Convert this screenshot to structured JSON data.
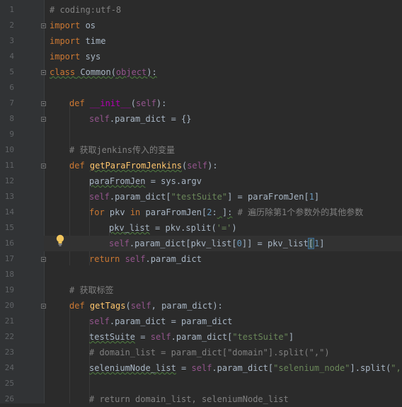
{
  "line_numbers": [
    "1",
    "2",
    "3",
    "4",
    "5",
    "6",
    "7",
    "8",
    "9",
    "10",
    "11",
    "12",
    "13",
    "14",
    "15",
    "16",
    "17",
    "18",
    "19",
    "20",
    "21",
    "22",
    "23",
    "24",
    "25",
    "26"
  ],
  "code": {
    "l1": [
      "# coding:utf-8"
    ],
    "l2": [
      "import",
      " os"
    ],
    "l3": [
      "import",
      " time"
    ],
    "l4": [
      "import",
      " sys"
    ],
    "l5": [
      "class",
      " Common(",
      "object",
      "):"
    ],
    "l7": [
      "def ",
      "__init__",
      "(",
      "self",
      "):"
    ],
    "l8": [
      "self",
      ".param_dict = {}"
    ],
    "l10": [
      "# 获取jenkins传入的变量"
    ],
    "l11": [
      "def ",
      "getParaFromJenkins",
      "(",
      "self",
      "):"
    ],
    "l12": [
      "paraFromJen",
      " = sys.argv"
    ],
    "l13": [
      "self",
      ".param_dict[",
      "\"testSuite\"",
      "] = paraFromJen[",
      "1",
      "]"
    ],
    "l14": [
      "for ",
      "pkv ",
      "in ",
      "paraFromJen[",
      "2",
      ":",
      " ",
      "]",
      ":",
      " # 遍历除第1个参数外的其他参数"
    ],
    "l15": [
      "pkv_list",
      " = pkv.split(",
      "'='",
      ")"
    ],
    "l16": [
      "self",
      ".param_dict[pkv_list[",
      "0",
      "]] = pkv_list",
      "[",
      "1",
      "]"
    ],
    "l17": [
      "return ",
      "self",
      ".param_dict"
    ],
    "l19": [
      "# 获取标签"
    ],
    "l20": [
      "def ",
      "getTags",
      "(",
      "self",
      ", param_dict):"
    ],
    "l21": [
      "self",
      ".param_dict = param_dict"
    ],
    "l22": [
      "testSuite",
      " = ",
      "self",
      ".param_dict[",
      "\"testSuite\"",
      "]"
    ],
    "l23": [
      "# domain_list = param_dict[\"domain\"].split(\",\")"
    ],
    "l24": [
      "seleniumNode_list",
      " = ",
      "self",
      ".param_dict[",
      "\"selenium_node\"",
      "].split(",
      "\",\"",
      ")"
    ],
    "l26": [
      "# return domain_list, seleniumNode_list"
    ]
  },
  "icons": {
    "gutter_hint": "lightbulb-icon",
    "fold": "fold-marker-icon"
  },
  "colors": {
    "background": "#2b2b2b",
    "gutter": "#313335",
    "keyword": "#cc7832",
    "comment": "#808080",
    "string": "#6a8759",
    "self": "#94558d",
    "function": "#ffc66d",
    "number": "#6897bb",
    "text": "#a9b7c6"
  }
}
